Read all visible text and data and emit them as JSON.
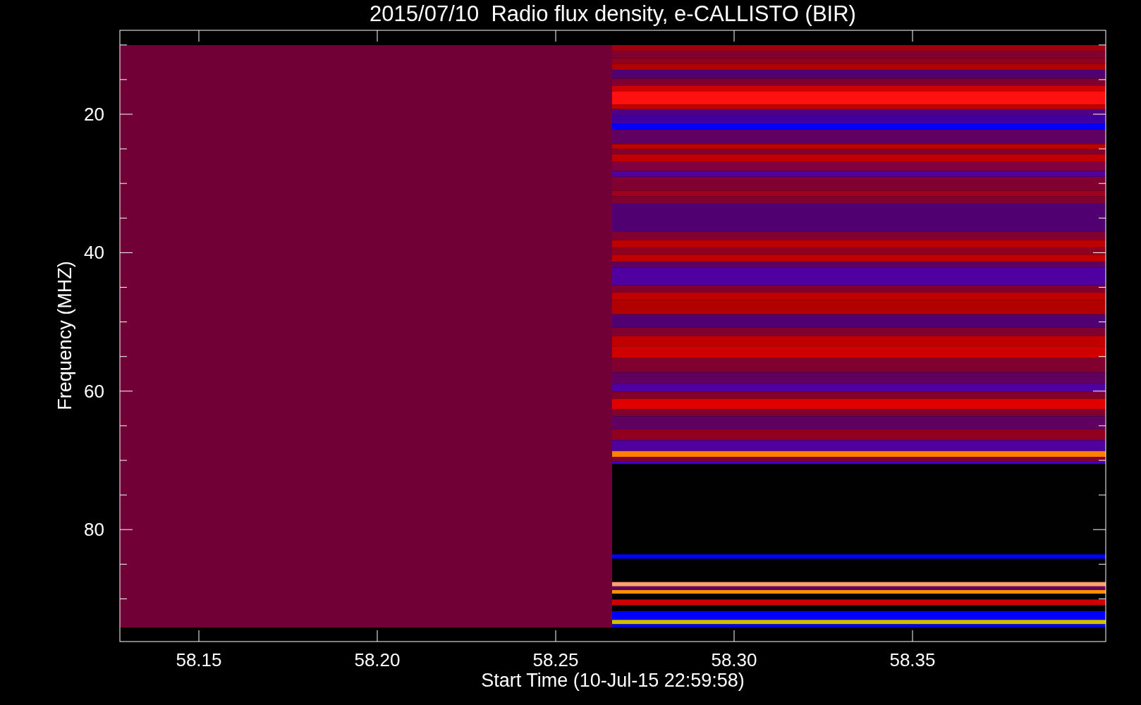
{
  "plot": {
    "title": "2015/07/10  Radio flux density, e-CALLISTO (BIR)",
    "y_axis": {
      "label": "Frequency (MHZ)",
      "ticks": [
        "20",
        "40",
        "60",
        "80"
      ]
    },
    "x_axis": {
      "label": "Start Time (10-Jul-15 22:59:58)",
      "ticks": [
        "58.15",
        "58.20",
        "58.25",
        "58.30",
        "58.35"
      ]
    }
  }
}
